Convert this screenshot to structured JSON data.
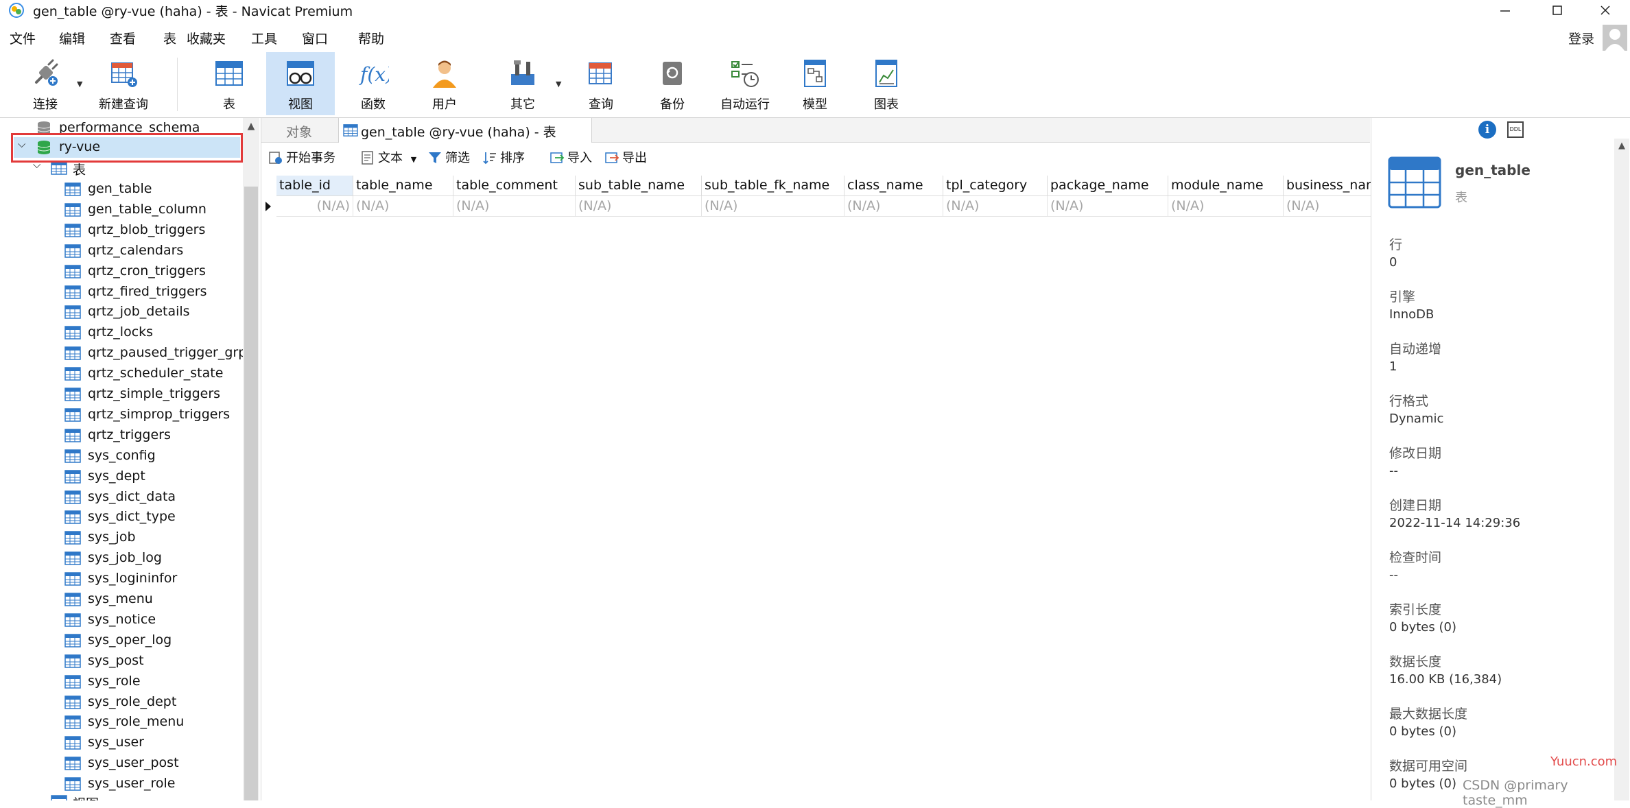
{
  "window": {
    "title": "gen_table @ry-vue (haha) - 表 - Navicat Premium"
  },
  "menu": {
    "items": [
      "文件",
      "编辑",
      "查看",
      "表",
      "收藏夹",
      "工具",
      "窗口",
      "帮助"
    ],
    "login": "登录"
  },
  "toolbar": {
    "connect": "连接",
    "new_query": "新建查询",
    "table": "表",
    "view": "视图",
    "function": "函数",
    "user": "用户",
    "other": "其它",
    "query": "查询",
    "backup": "备份",
    "auto_run": "自动运行",
    "model": "模型",
    "chart": "图表",
    "active": "视图"
  },
  "navigator": {
    "db_above": "performance_schema",
    "current_db": "ry-vue",
    "tables_folder": "表",
    "tables": [
      "gen_table",
      "gen_table_column",
      "qrtz_blob_triggers",
      "qrtz_calendars",
      "qrtz_cron_triggers",
      "qrtz_fired_triggers",
      "qrtz_job_details",
      "qrtz_locks",
      "qrtz_paused_trigger_grps",
      "qrtz_scheduler_state",
      "qrtz_simple_triggers",
      "qrtz_simprop_triggers",
      "qrtz_triggers",
      "sys_config",
      "sys_dept",
      "sys_dict_data",
      "sys_dict_type",
      "sys_job",
      "sys_job_log",
      "sys_logininfor",
      "sys_menu",
      "sys_notice",
      "sys_oper_log",
      "sys_post",
      "sys_role",
      "sys_role_dept",
      "sys_role_menu",
      "sys_user",
      "sys_user_post",
      "sys_user_role"
    ],
    "next_folder_partial": "视图"
  },
  "tabs": {
    "objects": "对象",
    "active": "gen_table @ry-vue (haha) - 表"
  },
  "subtoolbar": {
    "begin_transaction": "开始事务",
    "text": "文本",
    "filter": "筛选",
    "sort": "排序",
    "import": "导入",
    "export": "导出"
  },
  "grid": {
    "columns": [
      "table_id",
      "table_name",
      "table_comment",
      "sub_table_name",
      "sub_table_fk_name",
      "class_name",
      "tpl_category",
      "package_name",
      "module_name",
      "business_nam"
    ],
    "row": [
      "(N/A)",
      "(N/A)",
      "(N/A)",
      "(N/A)",
      "(N/A)",
      "(N/A)",
      "(N/A)",
      "(N/A)",
      "(N/A)",
      "(N/A)"
    ]
  },
  "info": {
    "name": "gen_table",
    "type": "表",
    "props": [
      {
        "label": "行",
        "value": "0"
      },
      {
        "label": "引擎",
        "value": "InnoDB"
      },
      {
        "label": "自动递增",
        "value": "1"
      },
      {
        "label": "行格式",
        "value": "Dynamic"
      },
      {
        "label": "修改日期",
        "value": "--"
      },
      {
        "label": "创建日期",
        "value": "2022-11-14 14:29:36"
      },
      {
        "label": "检查时间",
        "value": "--"
      },
      {
        "label": "索引长度",
        "value": "0 bytes (0)"
      },
      {
        "label": "数据长度",
        "value": "16.00 KB (16,384)"
      },
      {
        "label": "最大数据长度",
        "value": "0 bytes (0)"
      },
      {
        "label": "数据可用空间",
        "value": "0 bytes (0)"
      }
    ]
  },
  "overlay": {
    "watermark": "CSDN @primary taste_mm",
    "yuucn": "Yuucn.com"
  },
  "colors": {
    "accent": "#1b6ec2",
    "active_tool": "#cfe3f8",
    "selected_row": "#cce4f7",
    "highlight_box": "#e23a3a",
    "table_icon": "#2f78c8"
  }
}
